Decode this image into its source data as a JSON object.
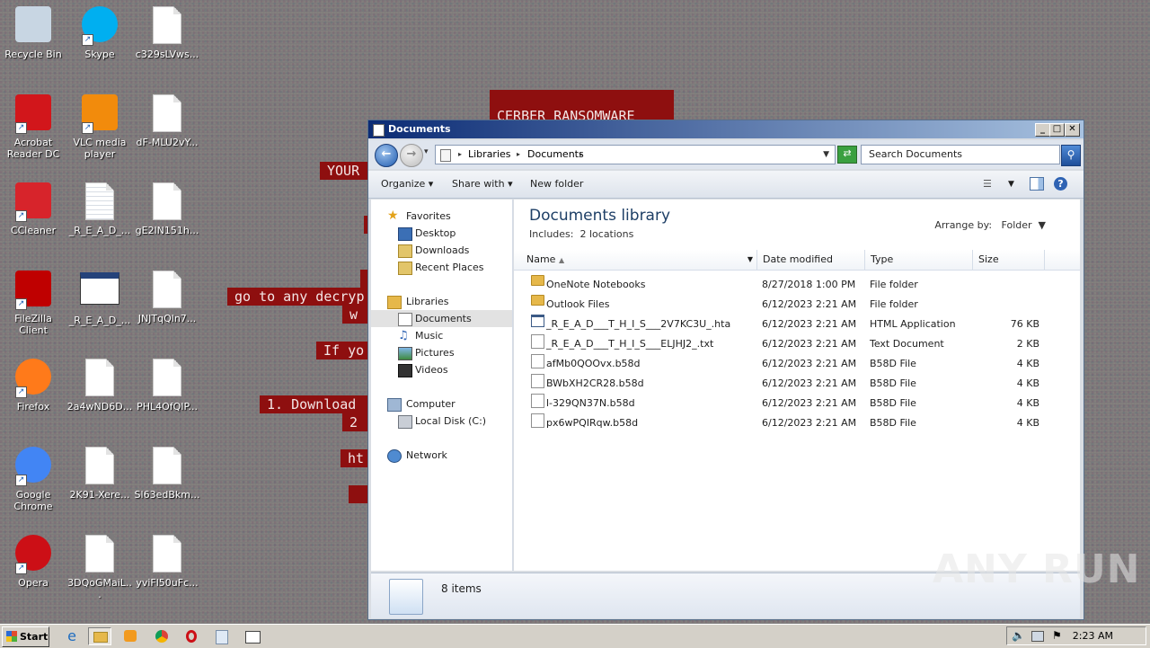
{
  "wallpaper": {
    "lines": [
      "CERBER RANSOMWARE",
      "YOUR",
      "go to any decryp",
      "w",
      "If yo",
      "1. Download",
      "2",
      "ht"
    ]
  },
  "desktop_icons": [
    {
      "label": "Recycle Bin",
      "icon": "recycle-bin-icon"
    },
    {
      "label": "Skype",
      "icon": "skype-icon"
    },
    {
      "label": "c329sLVws...",
      "icon": "file-icon"
    },
    {
      "label": "Acrobat Reader DC",
      "icon": "acrobat-icon"
    },
    {
      "label": "VLC media player",
      "icon": "vlc-icon"
    },
    {
      "label": "dF-MLU2vY...",
      "icon": "file-icon"
    },
    {
      "label": "CCleaner",
      "icon": "ccleaner-icon"
    },
    {
      "label": "_R_E_A_D_...",
      "icon": "text-file-icon"
    },
    {
      "label": "gE2lN151h...",
      "icon": "file-icon"
    },
    {
      "label": "FileZilla Client",
      "icon": "filezilla-icon"
    },
    {
      "label": "_R_E_A_D_...",
      "icon": "hta-file-icon"
    },
    {
      "label": "JNJTqQln7...",
      "icon": "file-icon"
    },
    {
      "label": "Firefox",
      "icon": "firefox-icon"
    },
    {
      "label": "2a4wND6D...",
      "icon": "file-icon"
    },
    {
      "label": "PHL4OfQIP...",
      "icon": "file-icon"
    },
    {
      "label": "Google Chrome",
      "icon": "chrome-icon"
    },
    {
      "label": "2K91-Xere...",
      "icon": "file-icon"
    },
    {
      "label": "Sl63edBkm...",
      "icon": "file-icon"
    },
    {
      "label": "Opera",
      "icon": "opera-icon"
    },
    {
      "label": "3DQoGMaiL...",
      "icon": "file-icon"
    },
    {
      "label": "yviFl50uFc...",
      "icon": "file-icon"
    }
  ],
  "window": {
    "title": "Documents",
    "buttons": {
      "minimize": "_",
      "maximize": "□",
      "close": "✕"
    },
    "breadcrumb": [
      "Libraries",
      "Documents"
    ],
    "search_placeholder": "Search Documents",
    "toolbar": {
      "organize": "Organize",
      "share_with": "Share with",
      "new_folder": "New folder"
    },
    "nav": {
      "favorites": "Favorites",
      "favorites_items": [
        "Desktop",
        "Downloads",
        "Recent Places"
      ],
      "libraries": "Libraries",
      "libraries_items": [
        "Documents",
        "Music",
        "Pictures",
        "Videos"
      ],
      "computer": "Computer",
      "computer_items": [
        "Local Disk (C:)"
      ],
      "network": "Network"
    },
    "library_title": "Documents library",
    "includes_label": "Includes:",
    "includes_link": "2 locations",
    "arrange_label": "Arrange by:",
    "arrange_value": "Folder",
    "columns": [
      "Name",
      "Date modified",
      "Type",
      "Size"
    ],
    "files": [
      {
        "name": "OneNote Notebooks",
        "date": "8/27/2018 1:00 PM",
        "type": "File folder",
        "size": "",
        "kind": "folder"
      },
      {
        "name": "Outlook Files",
        "date": "6/12/2023 2:21 AM",
        "type": "File folder",
        "size": "",
        "kind": "folder"
      },
      {
        "name": "_R_E_A_D___T_H_I_S___2V7KC3U_.hta",
        "date": "6/12/2023 2:21 AM",
        "type": "HTML Application",
        "size": "76 KB",
        "kind": "hta"
      },
      {
        "name": "_R_E_A_D___T_H_I_S___ELJHJ2_.txt",
        "date": "6/12/2023 2:21 AM",
        "type": "Text Document",
        "size": "2 KB",
        "kind": "file"
      },
      {
        "name": "afMb0QOOvx.b58d",
        "date": "6/12/2023 2:21 AM",
        "type": "B58D File",
        "size": "4 KB",
        "kind": "file"
      },
      {
        "name": "BWbXH2CR28.b58d",
        "date": "6/12/2023 2:21 AM",
        "type": "B58D File",
        "size": "4 KB",
        "kind": "file"
      },
      {
        "name": "l-329QN37N.b58d",
        "date": "6/12/2023 2:21 AM",
        "type": "B58D File",
        "size": "4 KB",
        "kind": "file"
      },
      {
        "name": "px6wPQIRqw.b58d",
        "date": "6/12/2023 2:21 AM",
        "type": "B58D File",
        "size": "4 KB",
        "kind": "file"
      }
    ],
    "status_items": "8 items"
  },
  "taskbar": {
    "start": "Start",
    "clock": "2:23 AM",
    "pinned": [
      "ie-icon",
      "explorer-icon",
      "media-player-icon",
      "chrome-icon",
      "opera-icon",
      "notepad-icon",
      "taskmanager-icon"
    ]
  },
  "watermark": "ANY RUN"
}
